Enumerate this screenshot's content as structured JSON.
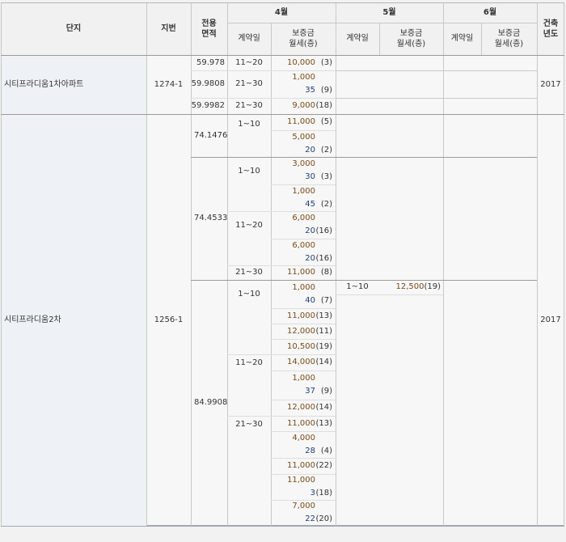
{
  "header": {
    "complex": "단지",
    "lot": "지번",
    "area": [
      "전용",
      "면적"
    ],
    "months": [
      "4월",
      "5월",
      "6월"
    ],
    "contract_day": "계약일",
    "deposit": "보증금",
    "rent_floor": "월세(층)",
    "built": [
      "건축",
      "년도"
    ]
  },
  "complexes": [
    {
      "name": "시티프라디움1차아파트",
      "lot": "1274-1",
      "year": "2017",
      "rows": [
        {
          "area": "59.978",
          "period": "11~20",
          "deposit": "10,000",
          "rent": "",
          "floor": "(3)"
        },
        {
          "area": "59.9808",
          "period": "21~30",
          "deposit": "1,000",
          "rent": "35",
          "floor": "(9)"
        },
        {
          "area": "59.9982",
          "period": "21~30",
          "deposit": "9,000",
          "rent": "",
          "floor": "(18)"
        }
      ]
    },
    {
      "name": "시티프라디움2차",
      "lot": "1256-1",
      "year": "2017",
      "areas": [
        "74.1476",
        "74.4533",
        "84.9908"
      ],
      "periods": [
        "1~10",
        "1~10",
        "11~20",
        "21~30",
        "1~10",
        "11~20",
        "21~30"
      ],
      "rows": [
        {
          "deposit": "11,000",
          "rent": "",
          "floor": "(5)"
        },
        {
          "deposit": "5,000",
          "rent": "20",
          "floor": "(2)"
        },
        {
          "deposit": "3,000",
          "rent": "30",
          "floor": "(3)"
        },
        {
          "deposit": "1,000",
          "rent": "45",
          "floor": "(2)"
        },
        {
          "deposit": "6,000",
          "rent": "20",
          "floor": "(16)"
        },
        {
          "deposit": "6,000",
          "rent": "20",
          "floor": "(16)"
        },
        {
          "deposit": "11,000",
          "rent": "",
          "floor": "(8)"
        },
        {
          "deposit": "1,000",
          "rent": "40",
          "floor": "(7)"
        },
        {
          "deposit": "11,000",
          "rent": "",
          "floor": "(13)"
        },
        {
          "deposit": "12,000",
          "rent": "",
          "floor": "(11)"
        },
        {
          "deposit": "10,500",
          "rent": "",
          "floor": "(19)"
        },
        {
          "deposit": "14,000",
          "rent": "",
          "floor": "(14)"
        },
        {
          "deposit": "1,000",
          "rent": "37",
          "floor": "(9)"
        },
        {
          "deposit": "12,000",
          "rent": "",
          "floor": "(14)"
        },
        {
          "deposit": "11,000",
          "rent": "",
          "floor": "(13)"
        },
        {
          "deposit": "4,000",
          "rent": "28",
          "floor": "(4)"
        },
        {
          "deposit": "11,000",
          "rent": "",
          "floor": "(22)"
        },
        {
          "deposit": "11,000",
          "rent": "3",
          "floor": "(18)"
        },
        {
          "deposit": "7,000",
          "rent": "22",
          "floor": "(20)"
        }
      ],
      "may": {
        "period": "1~10",
        "deposit": "12,500",
        "floor": "(19)"
      }
    }
  ],
  "colors": {
    "deposit": "#7a4a18",
    "rent": "#1f3e78",
    "header_bg": "#f1f1f1",
    "complex_bg": "#eef2f6",
    "grid_line": "#c8c8c8"
  }
}
